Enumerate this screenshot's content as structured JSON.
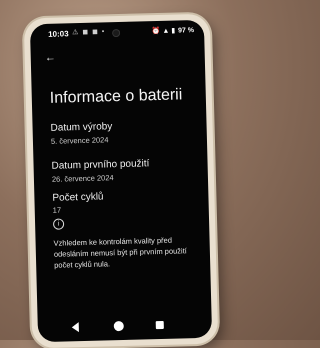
{
  "status_bar": {
    "time": "10:03",
    "left_icons": "⚠ ◼ ◼ •",
    "right_icons": "⏰ ▲ ▮",
    "battery": "97 %"
  },
  "icons": {
    "back": "arrow-back-icon",
    "info": "info-icon",
    "nav_back": "nav-back-icon",
    "nav_home": "nav-home-icon",
    "nav_recent": "nav-recent-icon"
  },
  "page": {
    "title": "Informace o baterii",
    "items": [
      {
        "label": "Datum výroby",
        "value": "5. července 2024"
      },
      {
        "label": "Datum prvního použití",
        "value": "26. července 2024"
      },
      {
        "label": "Počet cyklů",
        "value": "17"
      }
    ],
    "info_glyph": "i",
    "note": "Vzhledem ke kontrolám kvality před odesláním nemusí být při prvním použití počet cyklů nula."
  }
}
